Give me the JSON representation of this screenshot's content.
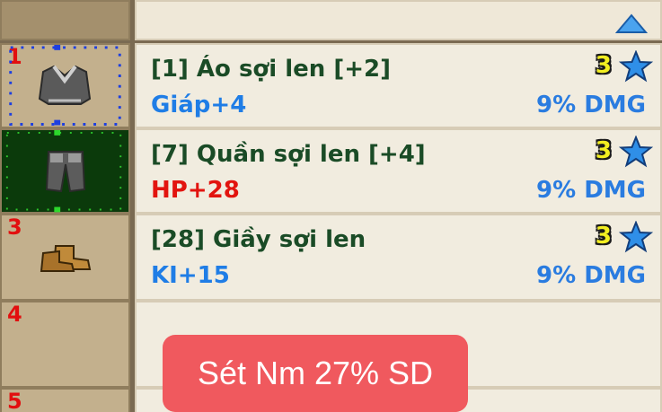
{
  "slots": [
    {
      "number": "1",
      "icon": "shirt-icon"
    },
    {
      "number": "",
      "icon": "pants-icon"
    },
    {
      "number": "3",
      "icon": "boots-icon"
    },
    {
      "number": "4",
      "icon": ""
    },
    {
      "number": "5",
      "icon": ""
    }
  ],
  "items": [
    {
      "name": "[1] Áo sợi len [+2]",
      "stat": "Giáp+4",
      "stat_color": "#1f7de6",
      "bonus": "9% DMG",
      "level": "3"
    },
    {
      "name": "[7] Quần sợi len [+4]",
      "stat": "HP+28",
      "stat_color": "#e2140f",
      "bonus": "9% DMG",
      "level": "3"
    },
    {
      "name": "[28] Giầy sợi len",
      "stat": "KI+15",
      "stat_color": "#1f7de6",
      "bonus": "9% DMG",
      "level": "3"
    }
  ],
  "toast": {
    "text": "Sét Nm 27% SD"
  },
  "colors": {
    "star": "#2f8fe8",
    "level": "#f2ee21",
    "toast_bg": "#f0595e"
  }
}
